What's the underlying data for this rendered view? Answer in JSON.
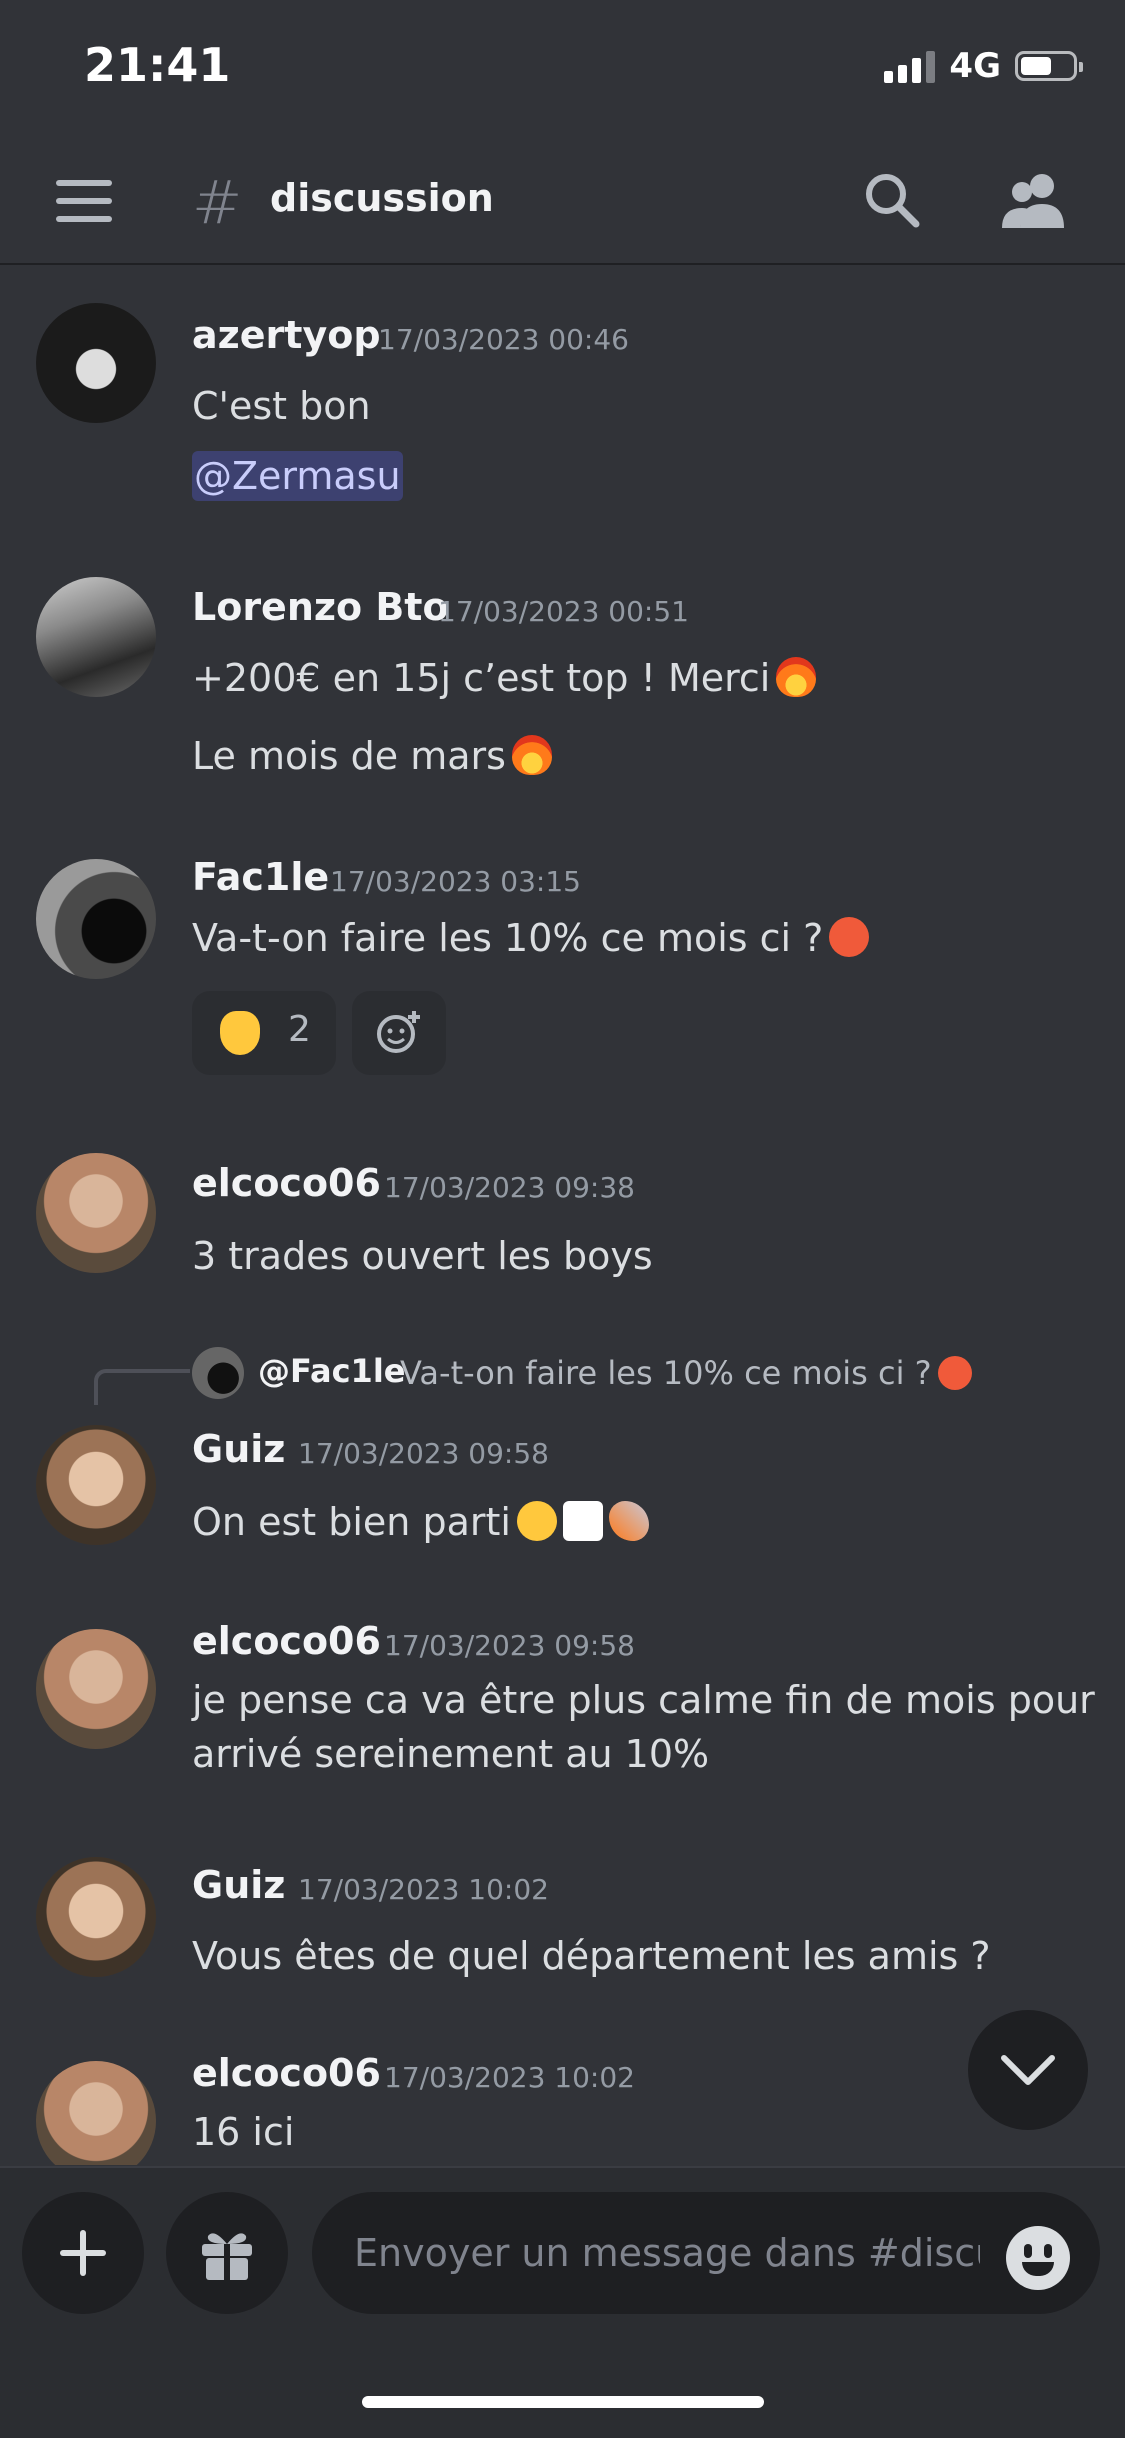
{
  "status_bar": {
    "time": "21:41",
    "network": "4G",
    "battery_level": 0.5
  },
  "header": {
    "channel_name": "discussion",
    "icons": [
      "menu-icon",
      "hash-icon",
      "search-icon",
      "members-icon"
    ]
  },
  "messages": [
    {
      "author": "azertyop",
      "timestamp": "17/03/2023 00:46",
      "lines": [
        "C'est bon"
      ],
      "mention": "@Zermasu"
    },
    {
      "author": "Lorenzo Bto",
      "timestamp": "17/03/2023 00:51",
      "lines": [
        "+200€ en 15j c’est top ! Merci",
        "Le mois de mars"
      ]
    },
    {
      "author": "Fac1le",
      "timestamp": "17/03/2023 03:15",
      "lines": [
        "Va-t-on faire les 10% ce mois ci ?"
      ],
      "reactions": [
        {
          "emoji": "crossed-fingers",
          "count": "2"
        }
      ]
    },
    {
      "author": "elcoco06",
      "timestamp": "17/03/2023 09:38",
      "lines": [
        "3 trades ouvert les boys"
      ]
    },
    {
      "author": "Guiz",
      "timestamp": "17/03/2023 09:58",
      "lines": [
        "On est bien parti"
      ],
      "reply_to": {
        "author": "@Fac1le",
        "text": "Va-t-on faire les 10% ce mois ci ?"
      }
    },
    {
      "author": "elcoco06",
      "timestamp": "17/03/2023 09:58",
      "lines": [
        "je pense ca va être plus calme fin de mois pour",
        "arrivé sereinement au 10%"
      ]
    },
    {
      "author": "Guiz",
      "timestamp": "17/03/2023 10:02",
      "lines": [
        "Vous êtes de quel département les amis ?"
      ]
    },
    {
      "author": "elcoco06",
      "timestamp": "17/03/2023 10:02",
      "lines": [
        "16 ici"
      ]
    }
  ],
  "composer": {
    "placeholder": "Envoyer un message dans #discus..."
  },
  "colors": {
    "background": "#313338",
    "composer": "#2b2d31",
    "mention_bg": "#3c4270",
    "mention_text": "#c9cdfb"
  }
}
